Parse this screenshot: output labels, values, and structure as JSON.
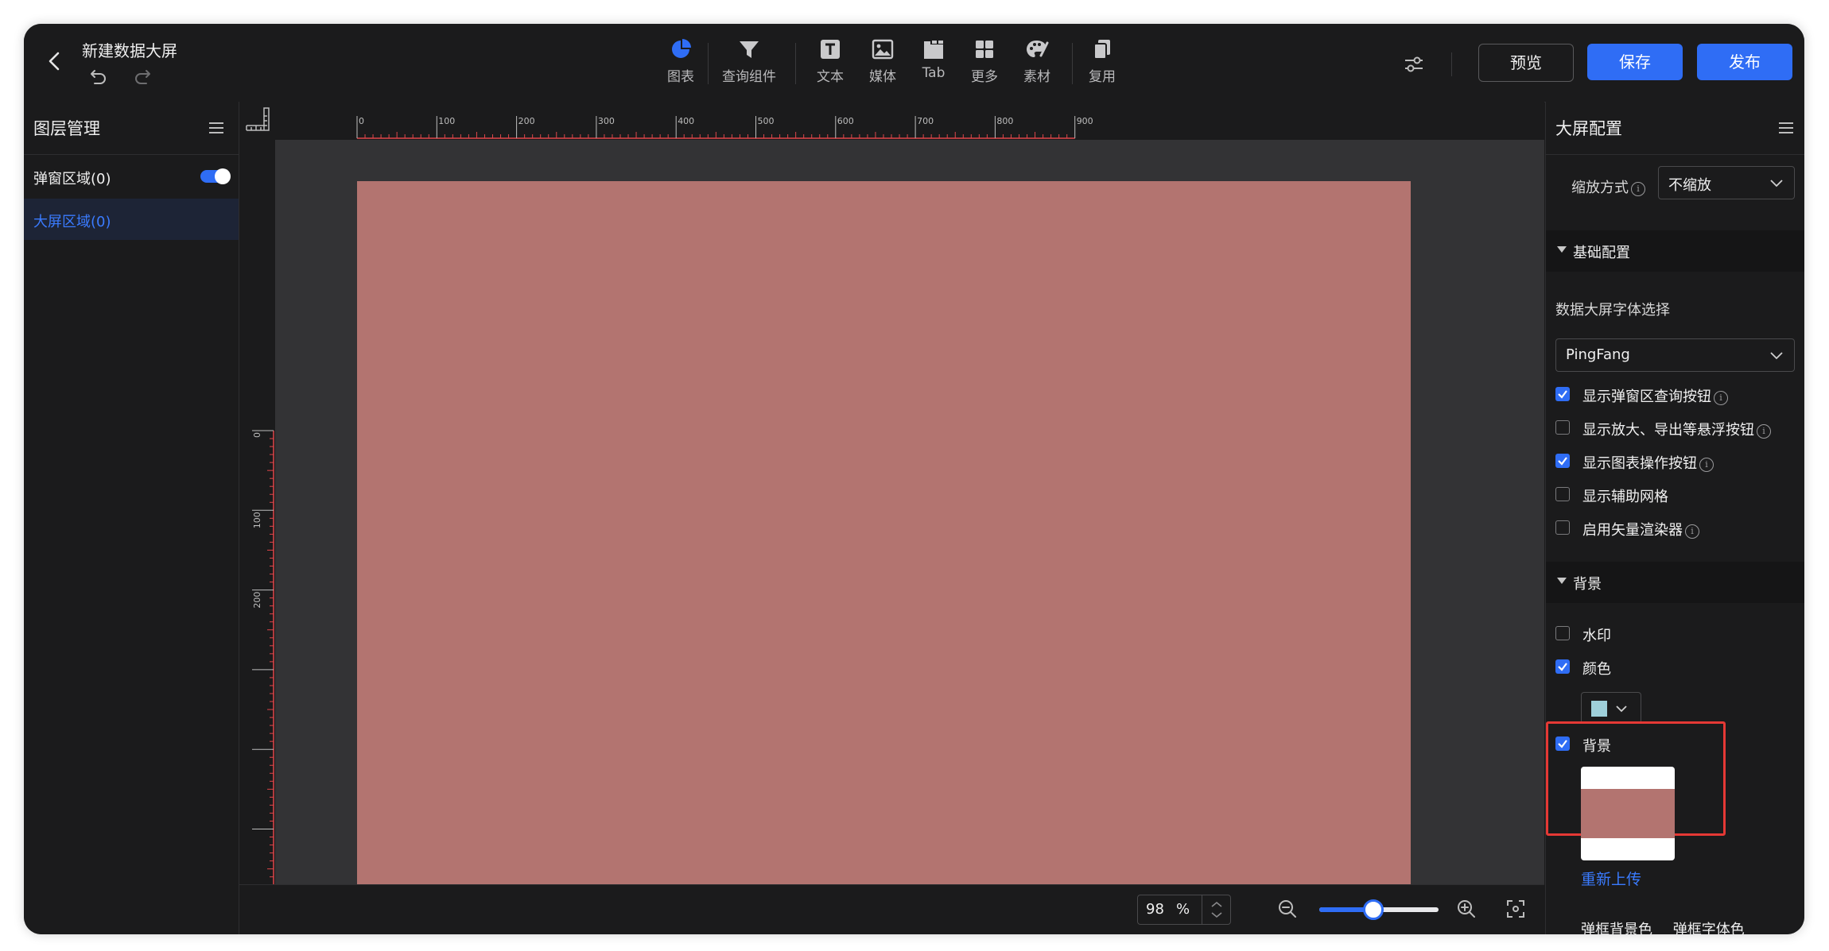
{
  "header": {
    "title": "新建数据大屏",
    "toolbar": [
      {
        "label": "图表",
        "icon": "pie-chart-icon"
      },
      {
        "label": "查询组件",
        "icon": "filter-icon"
      },
      {
        "label": "文本",
        "icon": "text-icon"
      },
      {
        "label": "媒体",
        "icon": "image-icon"
      },
      {
        "label": "Tab",
        "icon": "tab-icon"
      },
      {
        "label": "更多",
        "icon": "grid-icon"
      },
      {
        "label": "素材",
        "icon": "palette-icon"
      },
      {
        "label": "复用",
        "icon": "copy-icon"
      }
    ],
    "buttons": {
      "preview": "预览",
      "save": "保存",
      "publish": "发布"
    }
  },
  "layers": {
    "title": "图层管理",
    "popup_area": "弹窗区域(0)",
    "popup_toggle_on": true,
    "screen_area": "大屏区域(0)"
  },
  "ruler": {
    "top_ticks": [
      "0",
      "100",
      "200",
      "300",
      "400",
      "500",
      "600",
      "700",
      "800",
      "900"
    ],
    "left_ticks": [
      "0",
      "100",
      "200"
    ]
  },
  "zoom": {
    "value": "98",
    "unit": "%",
    "slider_fraction": 0.45
  },
  "config": {
    "title": "大屏配置",
    "scale_label": "缩放方式",
    "scale_value": "不缩放",
    "basic_section": "基础配置",
    "font_label": "数据大屏字体选择",
    "font_value": "PingFang",
    "options": [
      {
        "label": "显示弹窗区查询按钮",
        "checked": true,
        "info": true
      },
      {
        "label": "显示放大、导出等悬浮按钮",
        "checked": false,
        "info": true
      },
      {
        "label": "显示图表操作按钮",
        "checked": true,
        "info": true
      },
      {
        "label": "显示辅助网格",
        "checked": false,
        "info": false
      },
      {
        "label": "启用矢量渲染器",
        "checked": false,
        "info": true
      }
    ],
    "bg_section": "背景",
    "watermark": {
      "label": "水印",
      "checked": false
    },
    "color": {
      "label": "颜色",
      "checked": true,
      "swatch": "#9fd0da"
    },
    "background": {
      "label": "背景",
      "checked": true
    },
    "reupload": "重新上传",
    "popup_bg_color": "弹框背景色",
    "popup_font_color": "弹框字体色"
  },
  "colors": {
    "accent": "#2f6df5",
    "artboard": "#b37470",
    "highlight": "#e53935"
  }
}
